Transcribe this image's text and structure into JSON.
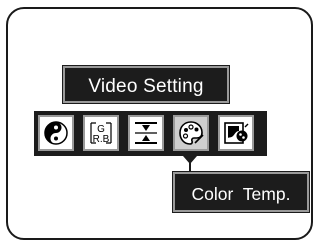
{
  "menu": {
    "title": "Video Setting",
    "selected_index": 3,
    "items": [
      {
        "icon": "contrast-icon",
        "label": ""
      },
      {
        "icon": "rgb-balance-icon",
        "label": "",
        "letters_top": "G",
        "letters_bottom": "R.B"
      },
      {
        "icon": "sharpness-icon",
        "label": ""
      },
      {
        "icon": "color-palette-icon",
        "label": "Color  Temp."
      },
      {
        "icon": "picture-mode-icon",
        "label": ""
      }
    ]
  },
  "tooltip": {
    "label": "Color  Temp."
  },
  "colors": {
    "panel": "#1c1c1c",
    "frame": "#9a9a9a",
    "selected_cell": "#cfcfcf",
    "text": "#ffffff"
  }
}
